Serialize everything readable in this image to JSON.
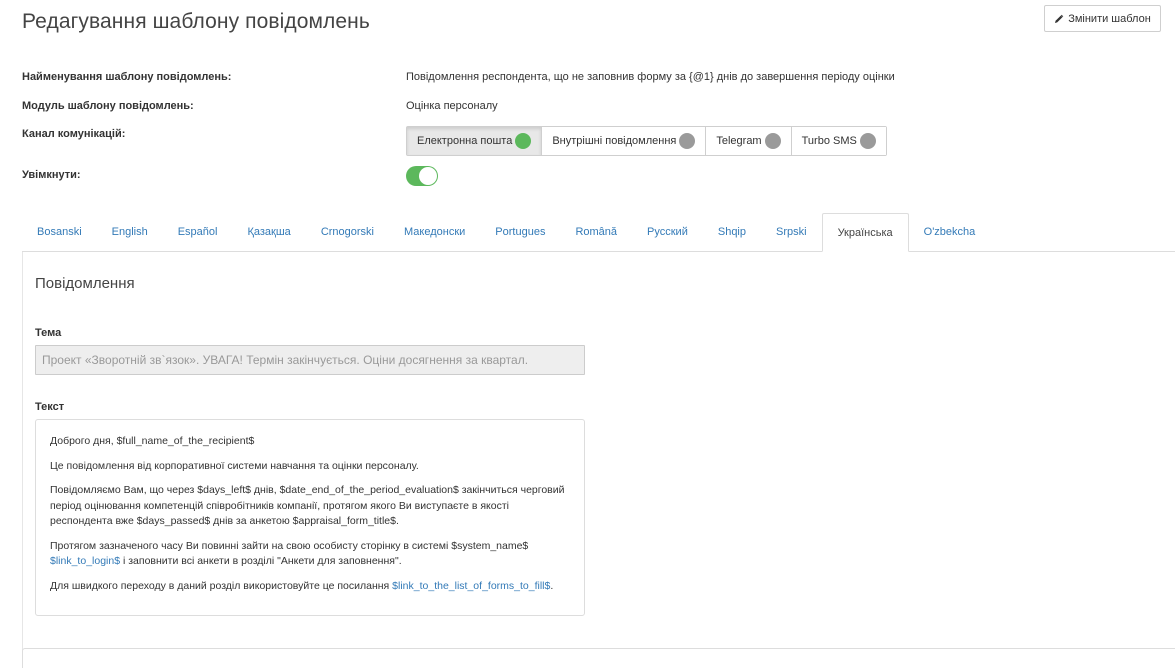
{
  "page": {
    "title": "Редагування шаблону повідомлень",
    "edit_button_label": "Змінити шаблон"
  },
  "fields": {
    "name_label": "Найменування шаблону повідомлень:",
    "name_value": "Повідомлення респондента, що не заповнив форму за {@1} днів до завершення періоду оцінки",
    "module_label": "Модуль шаблону повідомлень:",
    "module_value": "Оцінка персоналу",
    "channel_label": "Канал комунікацій:",
    "enabled_label": "Увімкнути:"
  },
  "channels": [
    {
      "label": "Електронна пошта",
      "active": true
    },
    {
      "label": "Внутрішні повідомлення",
      "active": false
    },
    {
      "label": "Telegram",
      "active": false
    },
    {
      "label": "Turbo SMS",
      "active": false
    }
  ],
  "toggle": {
    "enabled": true
  },
  "tabs": [
    {
      "label": "Bosanski"
    },
    {
      "label": "English"
    },
    {
      "label": "Español"
    },
    {
      "label": "Қазақша"
    },
    {
      "label": "Crnogorski"
    },
    {
      "label": "Македонски"
    },
    {
      "label": "Portugues"
    },
    {
      "label": "Română"
    },
    {
      "label": "Русский"
    },
    {
      "label": "Shqip"
    },
    {
      "label": "Srpski"
    },
    {
      "label": "Українська",
      "active": true
    },
    {
      "label": "O'zbekcha"
    }
  ],
  "message": {
    "section_title": "Повідомлення",
    "subject_label": "Тема",
    "subject_value": "Проект «Зворотній зв`язок». УВАГА! Термін закінчується. Оціни досягнення за квартал.",
    "text_label": "Текст",
    "body": {
      "p1": "Доброго дня, $full_name_of_the_recipient$",
      "p2": "Це повідомлення від корпоративної системи навчання та оцінки персоналу.",
      "p3": "Повідомляємо Вам, що через $days_left$ днів, $date_end_of_the_period_evaluation$ закінчиться черговий період оцінювання компетенцій співробітників компанії, протягом якого Ви виступаєте в якості респондента вже $days_passed$ днів за анкетою $appraisal_form_title$.",
      "p4_text": "Протягом зазначеного часу Ви повинні зайти на свою особисту сторінку в системі $system_name$",
      "p4_link": "$link_to_login$",
      "p4_tail": " і заповнити всі анкети в розділі \"Анкети для заповнення\".",
      "p5_text": "Для швидкого переходу в даний розділ використовуйте це посилання ",
      "p5_link": "$link_to_the_list_of_forms_to_fill$",
      "p5_tail": "."
    }
  },
  "colors": {
    "accent_link": "#337ab7",
    "toggle_on": "#5cb85c",
    "status_off": "#9a9a9a"
  }
}
